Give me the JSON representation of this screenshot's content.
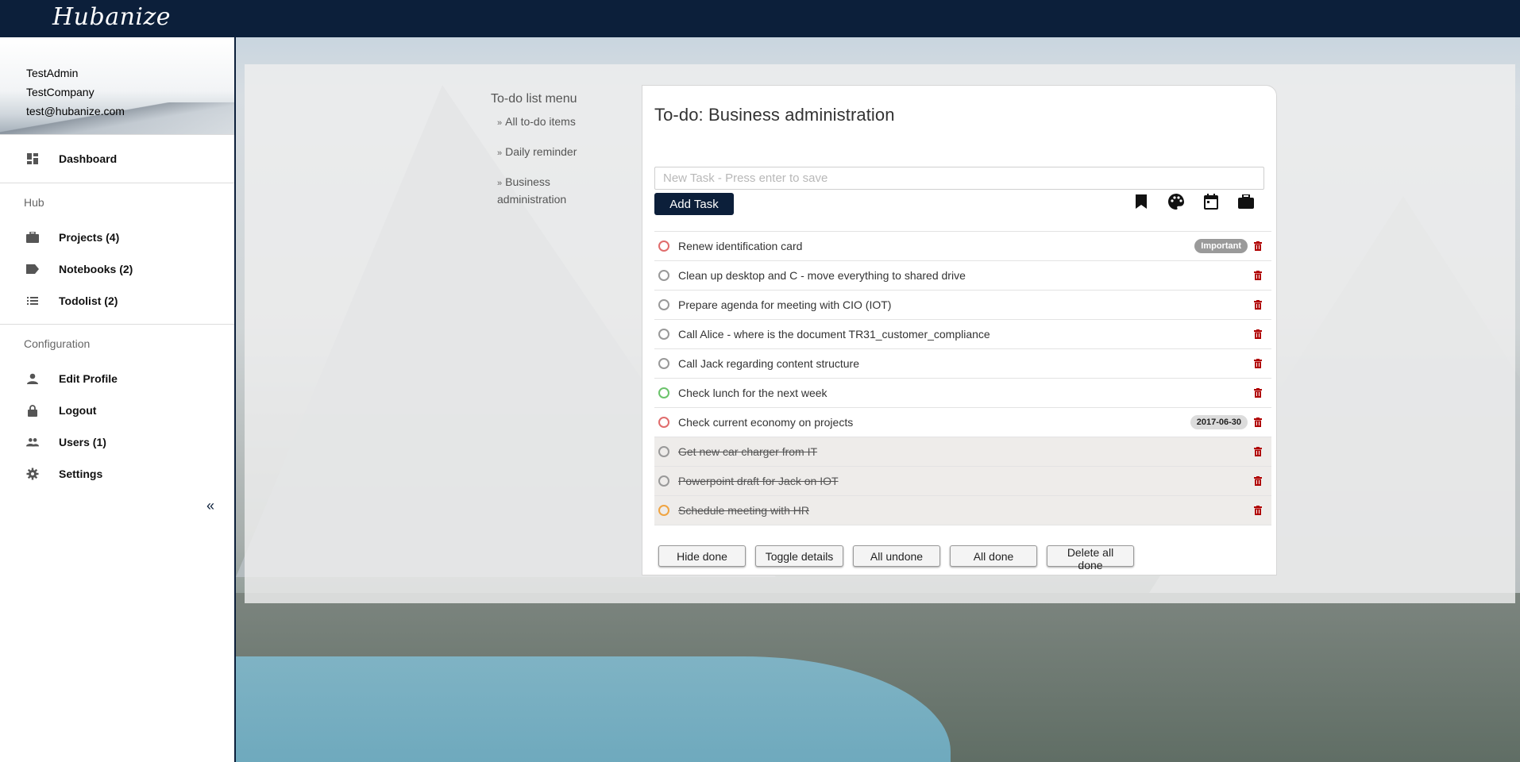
{
  "app": {
    "brand": "Hubanize"
  },
  "profile": {
    "username": "TestAdmin",
    "company": "TestCompany",
    "email": "test@hubanize.com"
  },
  "sidebar": {
    "dashboard": {
      "label": "Dashboard",
      "icon": "dashboard-icon"
    },
    "hub_heading": "Hub",
    "hub_items": [
      {
        "label": "Projects (4)",
        "icon": "briefcase-icon"
      },
      {
        "label": "Notebooks (2)",
        "icon": "label-icon"
      },
      {
        "label": "Todolist (2)",
        "icon": "list-icon"
      }
    ],
    "config_heading": "Configuration",
    "config_items": [
      {
        "label": "Edit Profile",
        "icon": "person-icon"
      },
      {
        "label": "Logout",
        "icon": "lock-icon"
      },
      {
        "label": "Users (1)",
        "icon": "people-icon"
      },
      {
        "label": "Settings",
        "icon": "gear-icon"
      }
    ],
    "collapse_label": "«"
  },
  "todo_menu": {
    "title": "To-do list menu",
    "items": [
      "All to-do items",
      "Daily reminder",
      "Business administration"
    ]
  },
  "panel": {
    "title": "To-do: Business administration",
    "input_placeholder": "New Task - Press enter to save",
    "add_label": "Add Task",
    "tools": [
      "bookmark-icon",
      "palette-icon",
      "calendar-icon",
      "briefcase-icon"
    ]
  },
  "tasks": [
    {
      "text": "Renew identification card",
      "status": "red",
      "done": false,
      "badge": "Important",
      "badge_type": "label"
    },
    {
      "text": "Clean up desktop and C - move everything to shared drive",
      "status": "grey",
      "done": false
    },
    {
      "text": "Prepare agenda for meeting with CIO (IOT)",
      "status": "grey",
      "done": false
    },
    {
      "text": "Call Alice - where is the document TR31_customer_compliance",
      "status": "grey",
      "done": false
    },
    {
      "text": "Call Jack regarding content structure",
      "status": "grey",
      "done": false
    },
    {
      "text": "Check lunch for the next week",
      "status": "green",
      "done": false
    },
    {
      "text": "Check current economy on projects",
      "status": "red",
      "done": false,
      "badge": "2017-06-30",
      "badge_type": "date"
    },
    {
      "text": "Get new car charger from IT",
      "status": "grey",
      "done": true
    },
    {
      "text": "Powerpoint draft for Jack on IOT",
      "status": "grey",
      "done": true
    },
    {
      "text": "Schedule meeting with HR",
      "status": "orange",
      "done": true
    }
  ],
  "footer": {
    "hide_done": "Hide done",
    "toggle_details": "Toggle details",
    "all_undone": "All undone",
    "all_done": "All done",
    "delete_all_done": "Delete all done"
  },
  "colors": {
    "navy": "#0c1f3a",
    "trash": "#c0392b"
  }
}
